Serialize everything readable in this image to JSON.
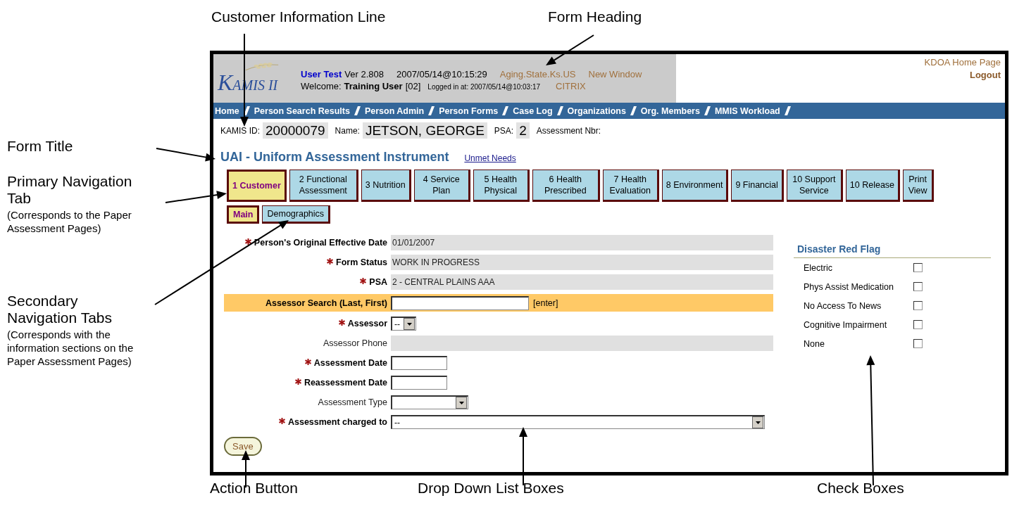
{
  "header": {
    "logo": "KAMIS II",
    "user": "User Test",
    "version": "Ver 2.808",
    "datetime": "2007/05/14@10:15:29",
    "links": [
      "Aging.State.Ks.US",
      "New Window"
    ],
    "welcome": "Welcome:",
    "user_name": "Training User",
    "user_code": "[02]",
    "logged_in": "Logged in at: 2007/05/14@10:03:17",
    "citrix": "CITRIX",
    "home_link": "KDOA Home Page",
    "logout": "Logout"
  },
  "nav": [
    "Home",
    "Person Search Results",
    "Person Admin",
    "Person Forms",
    "Case Log",
    "Organizations",
    "Org. Members",
    "MMIS Workload"
  ],
  "customer": [
    {
      "label": "KAMIS ID:",
      "value": "20000079"
    },
    {
      "label": "Name:",
      "value": "JETSON, GEORGE"
    },
    {
      "label": "PSA:",
      "value": "2"
    },
    {
      "label": "Assessment Nbr:"
    }
  ],
  "form_title": "UAI - Uniform Assessment Instrument",
  "unmet_link": "Unmet Needs",
  "tabs": [
    {
      "label": "1 Customer",
      "selected": true
    },
    {
      "label": "2 Functional Assessment",
      "selected": false
    },
    {
      "label": "3 Nutrition",
      "selected": false
    },
    {
      "label": "4 Service Plan",
      "selected": false
    },
    {
      "label": "5 Health Physical",
      "selected": false
    },
    {
      "label": "6 Health Prescribed",
      "selected": false
    },
    {
      "label": "7 Health Evaluation",
      "selected": false
    },
    {
      "label": "8 Environment",
      "selected": false
    },
    {
      "label": "9 Financial",
      "selected": false
    },
    {
      "label": "10 Support Service",
      "selected": false
    },
    {
      "label": "10 Release",
      "selected": false
    },
    {
      "label": "Print View",
      "selected": false
    }
  ],
  "subtabs": [
    {
      "label": "Main",
      "selected": true
    },
    {
      "label": "Demographics",
      "selected": false
    }
  ],
  "fields": [
    {
      "kind": "readonly",
      "label": "Person's Original Effective Date",
      "required": true,
      "value": "01/01/2007"
    },
    {
      "kind": "readonly",
      "label": "Form Status",
      "required": true,
      "value": "WORK IN PROGRESS"
    },
    {
      "kind": "readonly",
      "label": "PSA",
      "required": true,
      "value": "2 - CENTRAL PLAINS AAA"
    },
    {
      "kind": "search",
      "label": "Assessor Search (Last, First)",
      "required": false,
      "action": "[enter]"
    },
    {
      "kind": "select",
      "label": "Assessor",
      "required": true,
      "selection": "--"
    },
    {
      "kind": "readonly",
      "label": "Assessor Phone",
      "required": false
    },
    {
      "kind": "text",
      "label": "Assessment Date",
      "required": true
    },
    {
      "kind": "text",
      "label": "Reassessment Date",
      "required": true
    },
    {
      "kind": "select",
      "label": "Assessment Type",
      "required": false
    },
    {
      "kind": "select",
      "label": "Assessment charged to",
      "required": true,
      "selection": "--"
    }
  ],
  "save": "Save",
  "disaster": {
    "title": "Disaster Red Flag",
    "items": [
      {
        "label": "Electric",
        "checked": false
      },
      {
        "label": "Phys Assist Medication",
        "checked": false
      },
      {
        "label": "No Access To News",
        "checked": false
      },
      {
        "label": "Cognitive Impairment",
        "checked": false
      },
      {
        "label": "None",
        "checked": false
      }
    ]
  },
  "annotations": [
    {
      "text": "Customer Information Line"
    },
    {
      "text": "Form Heading"
    },
    {
      "text": "Form Title"
    },
    {
      "text": "Primary Navigation Tab",
      "note": "(Corresponds to the Paper Assessment Pages)"
    },
    {
      "text": "Secondary Navigation Tabs",
      "note": "(Corresponds with the information sections on the Paper Assessment Pages)"
    },
    {
      "text": "Action Button"
    },
    {
      "text": "Drop Down List Boxes"
    },
    {
      "text": "Check Boxes"
    }
  ]
}
